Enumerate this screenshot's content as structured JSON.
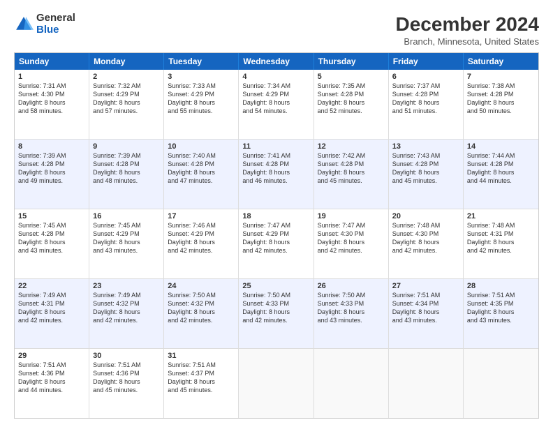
{
  "header": {
    "logo_line1": "General",
    "logo_line2": "Blue",
    "title": "December 2024",
    "subtitle": "Branch, Minnesota, United States"
  },
  "days": [
    "Sunday",
    "Monday",
    "Tuesday",
    "Wednesday",
    "Thursday",
    "Friday",
    "Saturday"
  ],
  "weeks": [
    [
      {
        "num": "1",
        "rise": "7:31 AM",
        "set": "4:30 PM",
        "day_hours": "8 hours",
        "day_min": "and 58 minutes."
      },
      {
        "num": "2",
        "rise": "7:32 AM",
        "set": "4:29 PM",
        "day_hours": "8 hours",
        "day_min": "and 57 minutes."
      },
      {
        "num": "3",
        "rise": "7:33 AM",
        "set": "4:29 PM",
        "day_hours": "8 hours",
        "day_min": "and 55 minutes."
      },
      {
        "num": "4",
        "rise": "7:34 AM",
        "set": "4:29 PM",
        "day_hours": "8 hours",
        "day_min": "and 54 minutes."
      },
      {
        "num": "5",
        "rise": "7:35 AM",
        "set": "4:28 PM",
        "day_hours": "8 hours",
        "day_min": "and 52 minutes."
      },
      {
        "num": "6",
        "rise": "7:37 AM",
        "set": "4:28 PM",
        "day_hours": "8 hours",
        "day_min": "and 51 minutes."
      },
      {
        "num": "7",
        "rise": "7:38 AM",
        "set": "4:28 PM",
        "day_hours": "8 hours",
        "day_min": "and 50 minutes."
      }
    ],
    [
      {
        "num": "8",
        "rise": "7:39 AM",
        "set": "4:28 PM",
        "day_hours": "8 hours",
        "day_min": "and 49 minutes."
      },
      {
        "num": "9",
        "rise": "7:39 AM",
        "set": "4:28 PM",
        "day_hours": "8 hours",
        "day_min": "and 48 minutes."
      },
      {
        "num": "10",
        "rise": "7:40 AM",
        "set": "4:28 PM",
        "day_hours": "8 hours",
        "day_min": "and 47 minutes."
      },
      {
        "num": "11",
        "rise": "7:41 AM",
        "set": "4:28 PM",
        "day_hours": "8 hours",
        "day_min": "and 46 minutes."
      },
      {
        "num": "12",
        "rise": "7:42 AM",
        "set": "4:28 PM",
        "day_hours": "8 hours",
        "day_min": "and 45 minutes."
      },
      {
        "num": "13",
        "rise": "7:43 AM",
        "set": "4:28 PM",
        "day_hours": "8 hours",
        "day_min": "and 45 minutes."
      },
      {
        "num": "14",
        "rise": "7:44 AM",
        "set": "4:28 PM",
        "day_hours": "8 hours",
        "day_min": "and 44 minutes."
      }
    ],
    [
      {
        "num": "15",
        "rise": "7:45 AM",
        "set": "4:28 PM",
        "day_hours": "8 hours",
        "day_min": "and 43 minutes."
      },
      {
        "num": "16",
        "rise": "7:45 AM",
        "set": "4:29 PM",
        "day_hours": "8 hours",
        "day_min": "and 43 minutes."
      },
      {
        "num": "17",
        "rise": "7:46 AM",
        "set": "4:29 PM",
        "day_hours": "8 hours",
        "day_min": "and 42 minutes."
      },
      {
        "num": "18",
        "rise": "7:47 AM",
        "set": "4:29 PM",
        "day_hours": "8 hours",
        "day_min": "and 42 minutes."
      },
      {
        "num": "19",
        "rise": "7:47 AM",
        "set": "4:30 PM",
        "day_hours": "8 hours",
        "day_min": "and 42 minutes."
      },
      {
        "num": "20",
        "rise": "7:48 AM",
        "set": "4:30 PM",
        "day_hours": "8 hours",
        "day_min": "and 42 minutes."
      },
      {
        "num": "21",
        "rise": "7:48 AM",
        "set": "4:31 PM",
        "day_hours": "8 hours",
        "day_min": "and 42 minutes."
      }
    ],
    [
      {
        "num": "22",
        "rise": "7:49 AM",
        "set": "4:31 PM",
        "day_hours": "8 hours",
        "day_min": "and 42 minutes."
      },
      {
        "num": "23",
        "rise": "7:49 AM",
        "set": "4:32 PM",
        "day_hours": "8 hours",
        "day_min": "and 42 minutes."
      },
      {
        "num": "24",
        "rise": "7:50 AM",
        "set": "4:32 PM",
        "day_hours": "8 hours",
        "day_min": "and 42 minutes."
      },
      {
        "num": "25",
        "rise": "7:50 AM",
        "set": "4:33 PM",
        "day_hours": "8 hours",
        "day_min": "and 42 minutes."
      },
      {
        "num": "26",
        "rise": "7:50 AM",
        "set": "4:33 PM",
        "day_hours": "8 hours",
        "day_min": "and 43 minutes."
      },
      {
        "num": "27",
        "rise": "7:51 AM",
        "set": "4:34 PM",
        "day_hours": "8 hours",
        "day_min": "and 43 minutes."
      },
      {
        "num": "28",
        "rise": "7:51 AM",
        "set": "4:35 PM",
        "day_hours": "8 hours",
        "day_min": "and 43 minutes."
      }
    ],
    [
      {
        "num": "29",
        "rise": "7:51 AM",
        "set": "4:36 PM",
        "day_hours": "8 hours",
        "day_min": "and 44 minutes."
      },
      {
        "num": "30",
        "rise": "7:51 AM",
        "set": "4:36 PM",
        "day_hours": "8 hours",
        "day_min": "and 45 minutes."
      },
      {
        "num": "31",
        "rise": "7:51 AM",
        "set": "4:37 PM",
        "day_hours": "8 hours",
        "day_min": "and 45 minutes."
      },
      null,
      null,
      null,
      null
    ]
  ],
  "labels": {
    "sunrise": "Sunrise:",
    "sunset": "Sunset:",
    "daylight": "Daylight:"
  }
}
